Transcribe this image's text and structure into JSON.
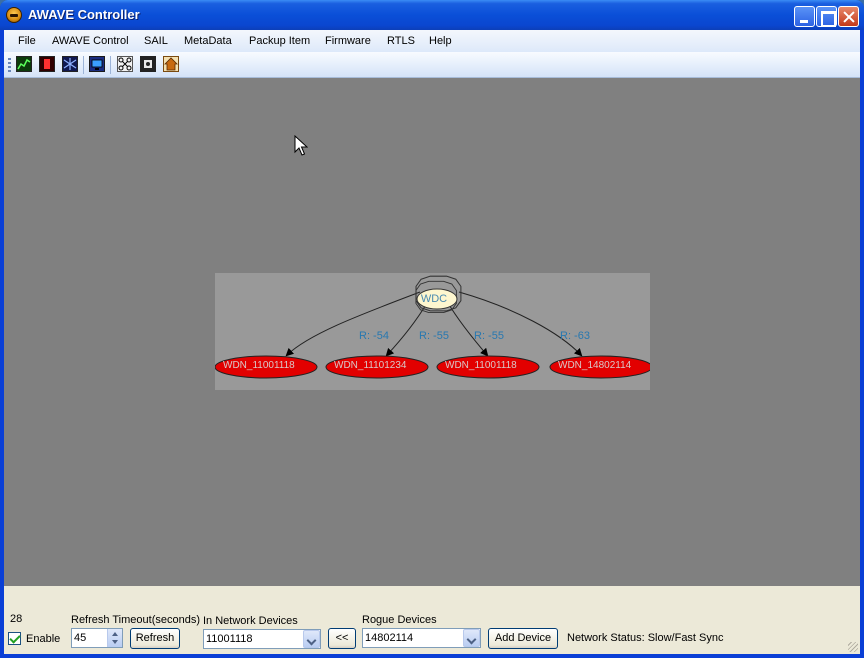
{
  "window": {
    "title": "AWAVE Controller"
  },
  "menu": [
    "File",
    "AWAVE Control",
    "SAIL",
    "MetaData",
    "Packup Item",
    "Firmware",
    "RTLS",
    "Help"
  ],
  "toolbar": {
    "icons": [
      "chart-icon",
      "record-icon",
      "network-icon",
      "monitor-icon",
      "nodes-icon",
      "device-icon",
      "home-icon"
    ]
  },
  "graph": {
    "root_label": "WDC",
    "edges": [
      {
        "rssi": "",
        "node": "WDN_11001118"
      },
      {
        "rssi": "R: -54",
        "node": "WDN_11101234"
      },
      {
        "rssi": "R: -55",
        "node": "WDN_11001118"
      },
      {
        "rssi": "R: -55",
        "node": ""
      },
      {
        "rssi": "R: -63",
        "node": "WDN_14802114"
      }
    ],
    "colors": {
      "node_fill": "#e20000",
      "root_fill": "#fdf6cf",
      "panel": "#999999",
      "background": "#808080"
    }
  },
  "status": {
    "counter": "28",
    "enable_label": "Enable",
    "enable_checked": true,
    "refresh_label": "Refresh Timeout(seconds)",
    "refresh_value": "45",
    "refresh_button": "Refresh",
    "in_network_label": "In Network Devices",
    "in_network_value": "11001118",
    "move_button": "<<",
    "rogue_label": "Rogue Devices",
    "rogue_value": "14802114",
    "add_button": "Add Device",
    "network_status": "Network Status: Slow/Fast Sync"
  }
}
